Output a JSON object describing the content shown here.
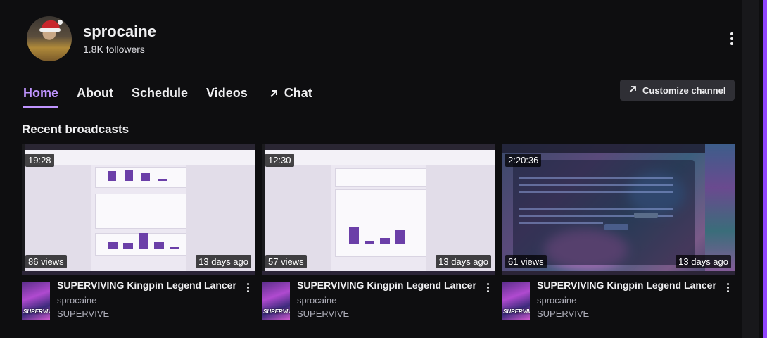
{
  "channel": {
    "name": "sprocaine",
    "followers": "1.8K followers"
  },
  "nav": {
    "items": [
      {
        "label": "Home"
      },
      {
        "label": "About"
      },
      {
        "label": "Schedule"
      },
      {
        "label": "Videos"
      },
      {
        "label": "Chat",
        "icon": "external-arrow-icon"
      }
    ],
    "active": "Home"
  },
  "customize": {
    "label": "Customize channel",
    "icon": "external-arrow-icon"
  },
  "section": {
    "title": "Recent broadcasts"
  },
  "videos": [
    {
      "duration": "19:28",
      "views": "86 views",
      "age": "13 days ago",
      "title": "SUPERVIVING Kingpin Legend Lancer",
      "channel": "sprocaine",
      "category": "SUPERVIVE"
    },
    {
      "duration": "12:30",
      "views": "57 views",
      "age": "13 days ago",
      "title": "SUPERVIVING Kingpin Legend Lancer",
      "channel": "sprocaine",
      "category": "SUPERVIVE"
    },
    {
      "duration": "2:20:36",
      "views": "61 views",
      "age": "13 days ago",
      "title": "SUPERVIVING Kingpin Legend Lancer",
      "channel": "sprocaine",
      "category": "SUPERVIVE"
    }
  ],
  "colors": {
    "background": "#0e0e10",
    "accent": "#bf94ff",
    "button_bg": "#2f2f35",
    "muted_text": "#adadb8"
  }
}
